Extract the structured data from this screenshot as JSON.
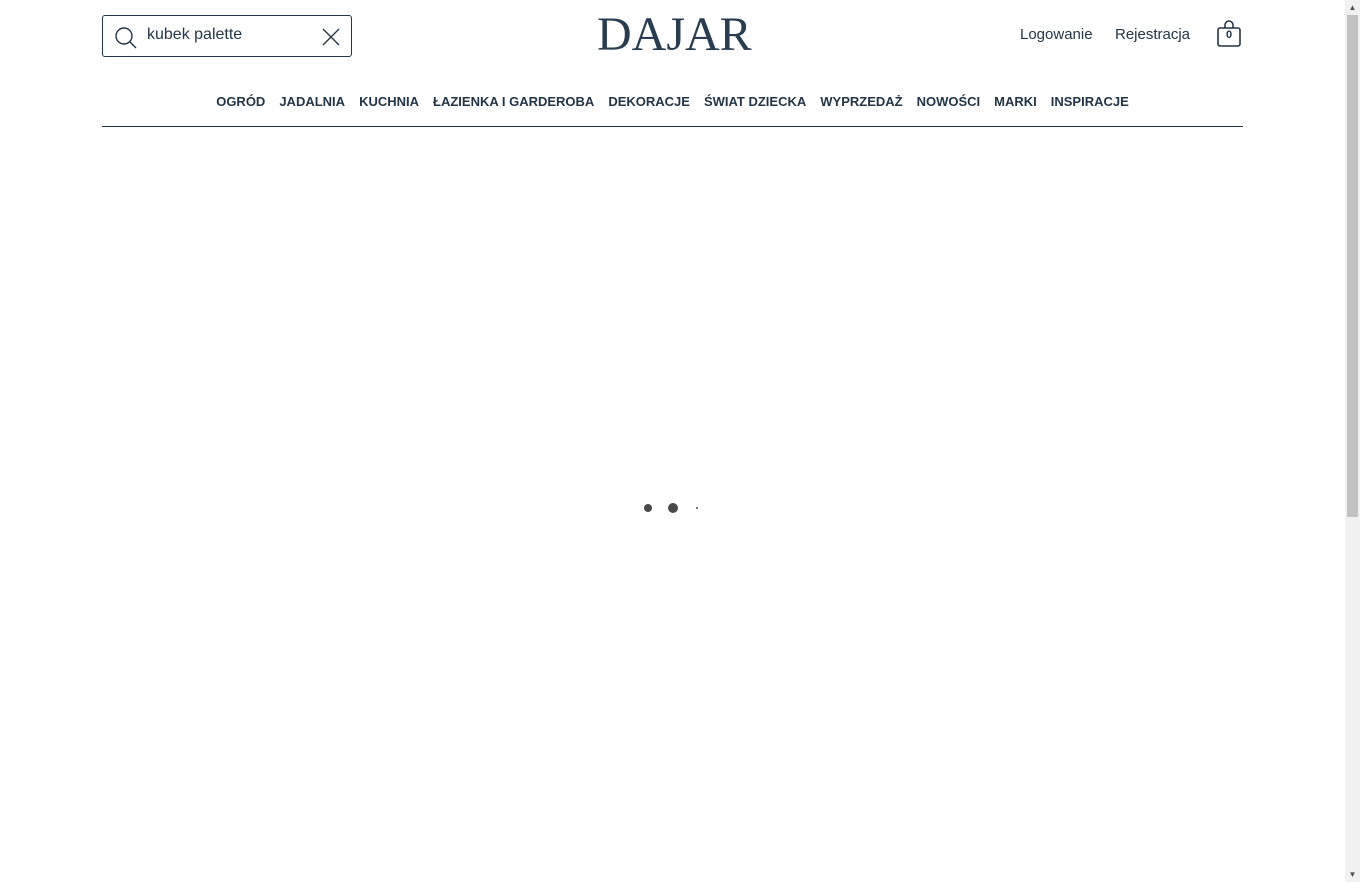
{
  "header": {
    "logo_text": "DAJAR",
    "search": {
      "value": "kubek palette",
      "icon": "search-icon",
      "clear_icon": "close-icon"
    },
    "account": {
      "login_label": "Logowanie",
      "register_label": "Rejestracja"
    },
    "cart": {
      "icon": "shopping-bag-icon",
      "count": "0"
    }
  },
  "nav": {
    "items": [
      {
        "label": "OGRÓD"
      },
      {
        "label": "JADALNIA"
      },
      {
        "label": "KUCHNIA"
      },
      {
        "label": "ŁAZIENKA I GARDEROBA"
      },
      {
        "label": "DEKORACJE"
      },
      {
        "label": "ŚWIAT DZIECKA"
      },
      {
        "label": "WYPRZEDAŻ"
      },
      {
        "label": "NOWOŚCI"
      },
      {
        "label": "MARKI"
      },
      {
        "label": "INSPIRACJE"
      }
    ]
  },
  "main": {
    "loading_indicator": "loading-dots"
  },
  "colors": {
    "primary": "#243545",
    "loader": "#4a4a4a",
    "scrollbar_track": "#f1f1f1",
    "scrollbar_thumb": "#c1c1c1"
  }
}
